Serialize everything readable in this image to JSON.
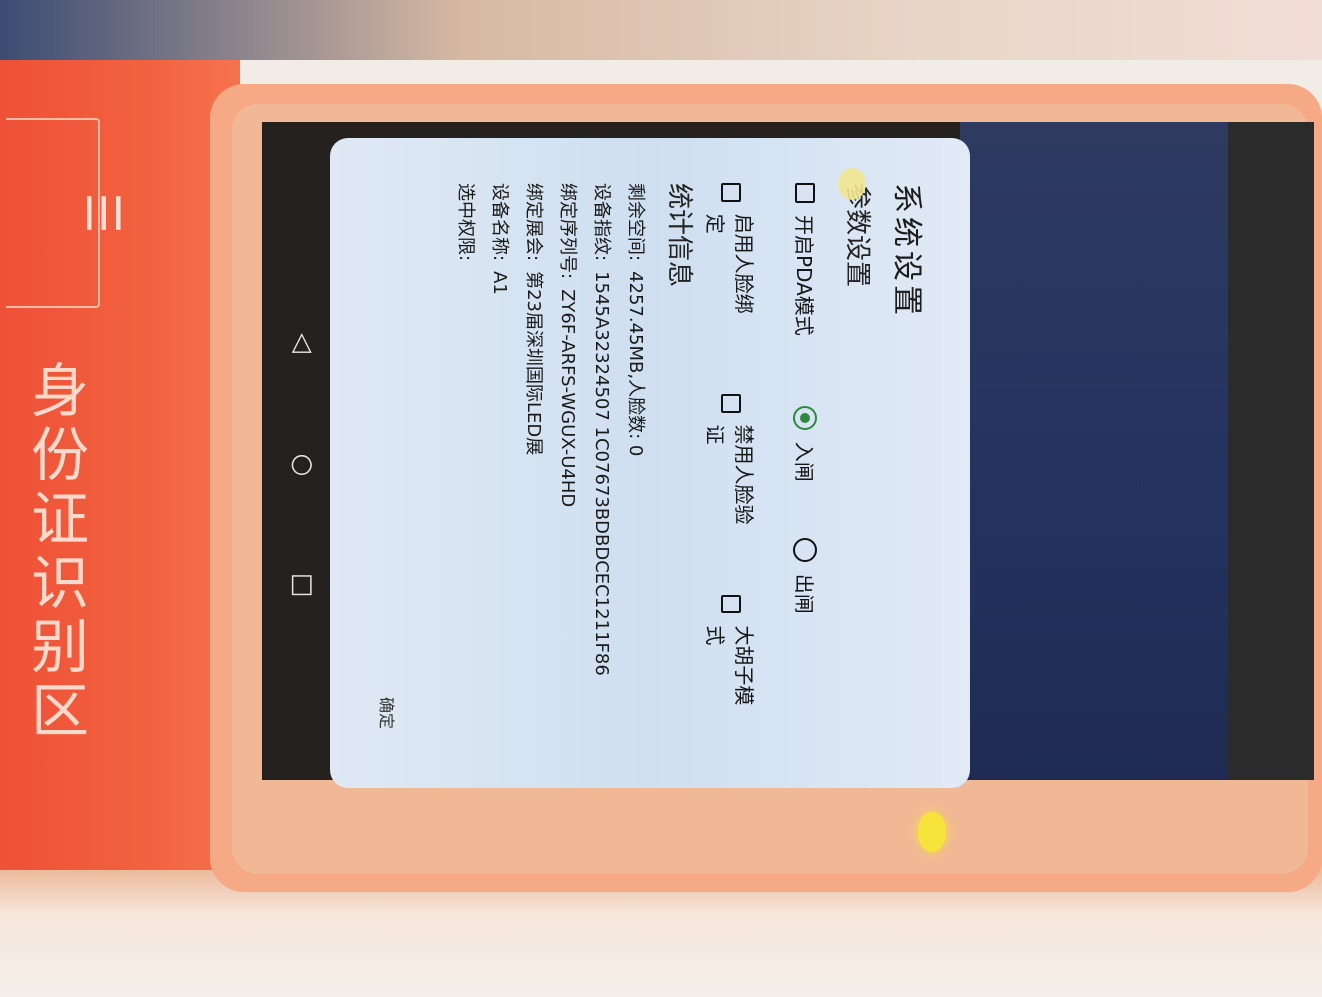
{
  "sign": {
    "logo_glyph": "☰",
    "text": "身份证识别区"
  },
  "navbar": {
    "back_glyph": "◁",
    "home_glyph": "○",
    "recents_glyph": "□"
  },
  "dialog": {
    "title": "系统设置",
    "params_section": "参数设置",
    "pda_mode": "开启PDA模式",
    "gate_in": "入闸",
    "gate_out": "出闸",
    "gate_selected": "in",
    "enable_face_bind": "启用人脸绑定",
    "disable_face_verify": "禁用人脸验证",
    "beard_mode": "大胡子模式",
    "stats_section": "统计信息",
    "stats": [
      {
        "label": "剩余空间:",
        "value": "4257.45MB,人脸数: 0"
      },
      {
        "label": "设备指纹:",
        "value": "1545A32324507 1C07673BDBDCEC1211F86"
      },
      {
        "label": "绑定序列号:",
        "value": "ZY6F-ARFS-WGUX-U4HD"
      },
      {
        "label": "绑定展会:",
        "value": "第23届深圳国际LED展"
      },
      {
        "label": "设备名称:",
        "value": "A1"
      },
      {
        "label": "选中权限:",
        "value": ""
      }
    ],
    "confirm": "确定"
  }
}
